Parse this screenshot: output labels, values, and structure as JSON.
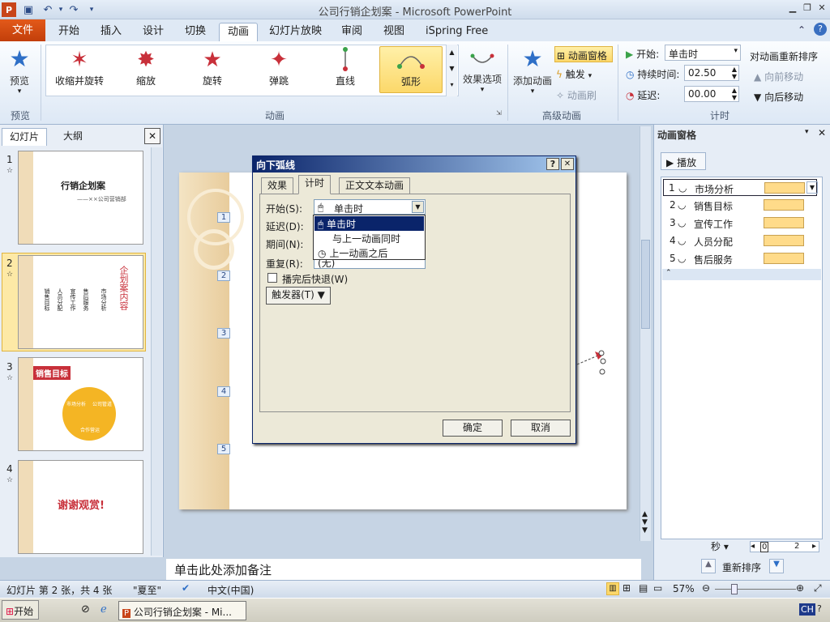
{
  "window": {
    "title": "公司行销企划案 - Microsoft PowerPoint",
    "app_icon": "P"
  },
  "tabs": {
    "file": "文件",
    "items": [
      "开始",
      "插入",
      "设计",
      "切换",
      "动画",
      "幻灯片放映",
      "审阅",
      "视图",
      "iSpring Free"
    ],
    "active": "动画"
  },
  "ribbon": {
    "preview": {
      "label": "预览",
      "group": "预览"
    },
    "effects": [
      "收缩并旋转",
      "缩放",
      "旋转",
      "弹跳",
      "直线",
      "弧形"
    ],
    "selected_effect": "弧形",
    "effect_options": "效果选项",
    "group_animation": "动画",
    "add_animation": "添加动画",
    "animation_pane": "动画窗格",
    "trigger": "触发",
    "animation_painter": "动画刷",
    "group_advanced": "高级动画",
    "start_label": "开始:",
    "start_value": "单击时",
    "duration_label": "持续时间:",
    "duration_value": "02.50",
    "delay_label": "延迟:",
    "delay_value": "00.00",
    "group_timing": "计时",
    "reorder_title": "对动画重新排序",
    "move_earlier": "向前移动",
    "move_later": "向后移动"
  },
  "left_panel": {
    "tab_slides": "幻灯片",
    "tab_outline": "大纲",
    "slides": [
      {
        "num": "1",
        "title": "行销企划案",
        "subtitle": "——××公司营销部"
      },
      {
        "num": "2",
        "title": "企划案内容",
        "cols": [
          "销售目标",
          "人员分配",
          "宣传工作",
          "售后服务",
          "市场分析"
        ]
      },
      {
        "num": "3",
        "title": "销售目标",
        "items": [
          "市场分析",
          "公司管道",
          "合作营运"
        ]
      },
      {
        "num": "4",
        "title": "谢谢观赏!"
      }
    ]
  },
  "slide_tags": [
    "1",
    "2",
    "3",
    "4",
    "5"
  ],
  "notes_placeholder": "单击此处添加备注",
  "dialog": {
    "title": "向下弧线",
    "help": "?",
    "close": "✕",
    "tabs": [
      "效果",
      "计时",
      "正文文本动画"
    ],
    "active_tab": "计时",
    "start_label": "开始(S):",
    "start_value": "单击时",
    "delay_label": "延迟(D):",
    "period_label": "期间(N):",
    "repeat_label": "重复(R):",
    "repeat_value": "(无)",
    "rewind_label": "播完后快退(W)",
    "trigger_button": "触发器(T)",
    "ok": "确定",
    "cancel": "取消",
    "dropdown_options": [
      "单击时",
      "与上一动画同时",
      "上一动画之后"
    ]
  },
  "anim_pane": {
    "title": "动画窗格",
    "play": "播放",
    "items": [
      {
        "num": "1",
        "name": "市场分析"
      },
      {
        "num": "2",
        "name": "销售目标"
      },
      {
        "num": "3",
        "name": "宣传工作"
      },
      {
        "num": "4",
        "name": "人员分配"
      },
      {
        "num": "5",
        "name": "售后服务"
      }
    ],
    "seconds": "秒",
    "timeline_start": "0",
    "timeline_end": "2",
    "reorder": "重新排序"
  },
  "status": {
    "slide_info": "幻灯片 第 2 张，共 4 张",
    "theme": "\"夏至\"",
    "language": "中文(中国)",
    "zoom": "57%"
  },
  "taskbar": {
    "start": "开始",
    "task": "公司行销企划案 - Mi...",
    "ime": "CH"
  }
}
